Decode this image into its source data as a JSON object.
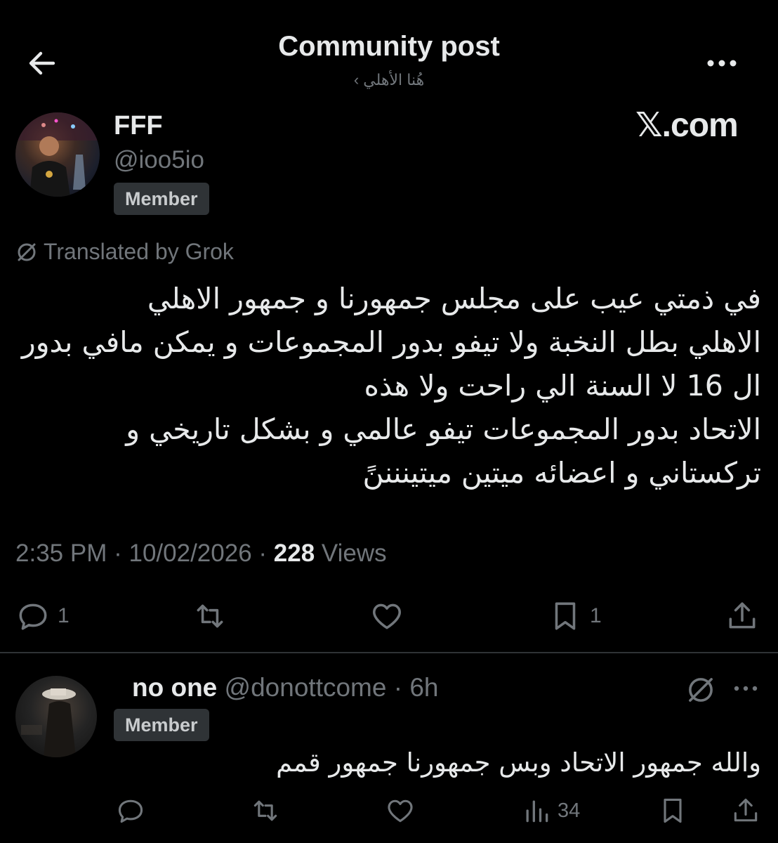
{
  "header": {
    "title": "Community post",
    "community": "هُنا الأهلي ›"
  },
  "post": {
    "author_name": "FFF",
    "author_handle": "@ioo5io",
    "badge": "Member",
    "watermark": "𝕏.com",
    "translated_label": "Translated by Grok",
    "body_lines": [
      "في ذمتي عيب على مجلس جمهورنا و جمهور الاهلي",
      "الاهلي بطل النخبة ولا تيفو بدور المجموعات و يمكن مافي بدور",
      "ال 16 لا السنة الي راحت ولا هذه",
      "الاتحاد بدور المجموعات تيفو عالمي و بشكل تاريخي و",
      "تركستاني و اعضائه ميتين ميتيننننً"
    ],
    "time": "2:35 PM",
    "date": "10/02/2026",
    "views_count": "228",
    "views_label": "Views",
    "reply_count": "1",
    "bookmark_count": "1"
  },
  "reply": {
    "name": "no one",
    "handle": "@donottcome",
    "sep": "·",
    "age": "6h",
    "badge": "Member",
    "body": "والله جمهور الاتحاد وبس جمهورنا جمهور قمم",
    "views_count": "34"
  },
  "icons": [
    "back-arrow-icon",
    "more-icon",
    "grok-translate-icon",
    "reply-icon",
    "repost-icon",
    "like-icon",
    "bookmark-icon",
    "share-icon",
    "views-icon"
  ],
  "colors": {
    "background": "#000000",
    "text": "#e7e9ea",
    "muted": "#71767b",
    "badge_bg": "#2f3336"
  }
}
